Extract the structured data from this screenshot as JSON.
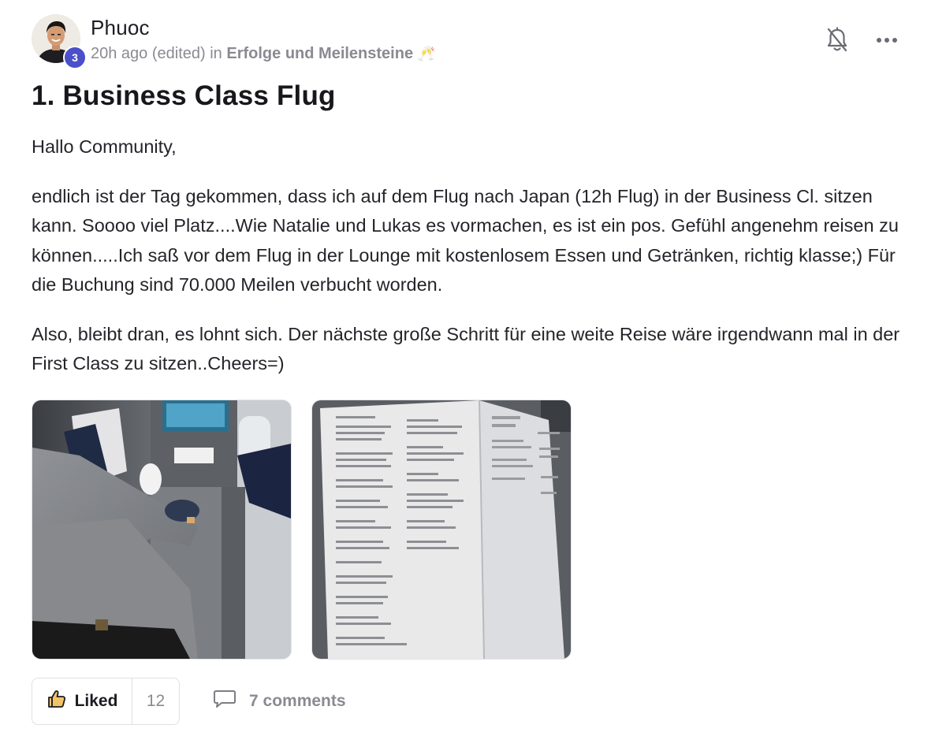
{
  "post": {
    "author": {
      "name": "Phuoc",
      "level": "3",
      "avatar_icon": "user-avatar"
    },
    "meta": {
      "time": "20h ago",
      "edited": "(edited)",
      "in_label": "in",
      "space": "Erfolge und Meilensteine",
      "space_emoji": "🥂"
    },
    "title": "1. Business Class Flug",
    "paragraphs": [
      "Hallo Community,",
      "endlich ist der Tag gekommen, dass ich auf dem Flug nach Japan (12h Flug) in der Business Cl. sitzen kann. Soooo viel Platz....Wie Natalie und Lukas es vormachen, es ist ein pos. Gefühl angenehm reisen zu können.....Ich saß vor dem Flug in der Lounge mit kostenlosem Essen und Getränken, richtig klasse;) Für die Buchung sind 70.000 Meilen verbucht worden.",
      "Also, bleibt dran, es lohnt sich. Der nächste große Schritt für eine weite Reise wäre irgendwann mal in der First Class zu sitzen..Cheers=)"
    ],
    "images": [
      {
        "icon": "business-class-seat-photo"
      },
      {
        "icon": "menu-card-photo"
      }
    ],
    "actions": {
      "like_label": "Liked",
      "like_count": "12",
      "comments_label": "7 comments"
    },
    "icons": {
      "bell": "bell-off-icon",
      "more": "more-horizontal-icon",
      "like": "thumbs-up-icon",
      "comment": "comment-bubble-icon"
    },
    "colors": {
      "badge": "#4b4fc9",
      "muted_text": "#8a8a92",
      "primary_text": "#1c1c22",
      "like_icon": "#e0a73c"
    }
  }
}
